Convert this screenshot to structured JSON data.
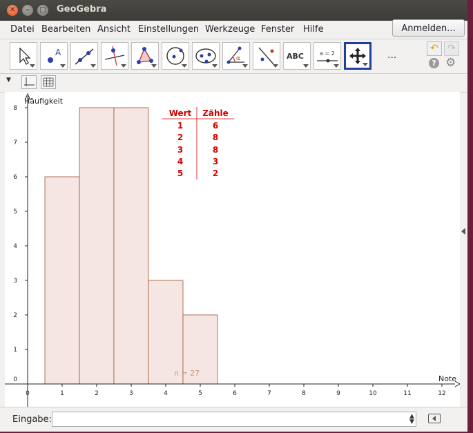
{
  "window": {
    "title": "GeoGebra"
  },
  "menu": [
    "Datei",
    "Bearbeiten",
    "Ansicht",
    "Einstellungen",
    "Werkzeuge",
    "Fenster",
    "Hilfe"
  ],
  "login_label": "Anmelden...",
  "toolbar": {
    "tools": [
      {
        "name": "move-tool-icon"
      },
      {
        "name": "point-tool-icon",
        "text": "A"
      },
      {
        "name": "line-tool-icon"
      },
      {
        "name": "perpendicular-line-tool-icon"
      },
      {
        "name": "polygon-tool-icon"
      },
      {
        "name": "circle-center-point-tool-icon"
      },
      {
        "name": "ellipse-tool-icon"
      },
      {
        "name": "angle-tool-icon",
        "text": "α"
      },
      {
        "name": "reflect-tool-icon"
      },
      {
        "name": "text-tool-icon",
        "text": "ABC"
      },
      {
        "name": "slider-tool-icon",
        "text": "a = 2"
      },
      {
        "name": "move-graphics-view-tool-icon"
      }
    ],
    "more": "..."
  },
  "graphics": {
    "table": {
      "headers": [
        "Wert",
        "Zähle"
      ],
      "rows": [
        [
          "1",
          "6"
        ],
        [
          "2",
          "8"
        ],
        [
          "3",
          "8"
        ],
        [
          "4",
          "3"
        ],
        [
          "5",
          "2"
        ]
      ]
    },
    "n_label": "n = 27"
  },
  "chart_data": {
    "type": "bar",
    "categories": [
      "1",
      "2",
      "3",
      "4",
      "5"
    ],
    "values": [
      6,
      8,
      8,
      3,
      2
    ],
    "xlabel": "Note",
    "ylabel": "Häufigkeit",
    "xlim": [
      -0.5,
      12.7
    ],
    "ylim": [
      0,
      8.2
    ],
    "x_ticks": [
      0,
      1,
      2,
      3,
      4,
      5,
      6,
      7,
      8,
      9,
      10,
      11,
      12
    ],
    "y_ticks": [
      0,
      1,
      2,
      3,
      4,
      5,
      6,
      7,
      8
    ],
    "bar_fill": "#f5e6e3",
    "bar_stroke": "#a0522d",
    "grid": false
  },
  "colors": {
    "table_text": "#d40000",
    "n_label": "#c89a7a"
  },
  "input_bar": {
    "label": "Eingabe:",
    "value": ""
  }
}
